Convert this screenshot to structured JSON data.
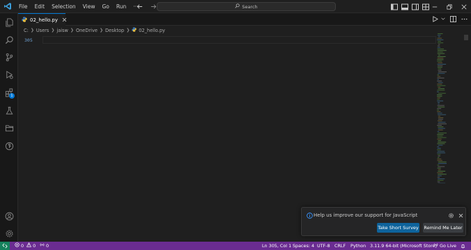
{
  "menu": [
    "File",
    "Edit",
    "Selection",
    "View",
    "Go",
    "Run",
    "···"
  ],
  "search": {
    "label": "Search"
  },
  "tab": {
    "label": "02_hello.py"
  },
  "breadcrumb": [
    "C:",
    "Users",
    "jaisw",
    "OneDrive",
    "Desktop",
    "02_hello.py"
  ],
  "editor": {
    "line_number": "305"
  },
  "activity": {
    "extensions_badge": "1"
  },
  "notification": {
    "message": "Help us improve our support for JavaScript",
    "primary_button": "Take Short Survey",
    "secondary_button": "Remind Me Later"
  },
  "status": {
    "errors": "0",
    "warnings": "0",
    "ports": "0",
    "position": "Ln 305, Col 1",
    "spaces": "Spaces: 4",
    "encoding": "UTF-8",
    "eol": "CRLF",
    "language": "Python",
    "interpreter": "3.11.9 64-bit (Microsoft Store)",
    "golive": "Go Live"
  },
  "colors": {
    "statusbar": "#6a2c91",
    "remote": "#16825d",
    "accent": "#0078d4",
    "primary_button": "#0e639c"
  },
  "icons": [
    "vscode-logo-icon",
    "files-icon",
    "search-icon",
    "source-control-icon",
    "run-debug-icon",
    "extensions-icon",
    "testing-icon",
    "folder-icon",
    "gitlens-icon",
    "account-icon",
    "settings-gear-icon",
    "python-file-icon",
    "bell-icon"
  ]
}
